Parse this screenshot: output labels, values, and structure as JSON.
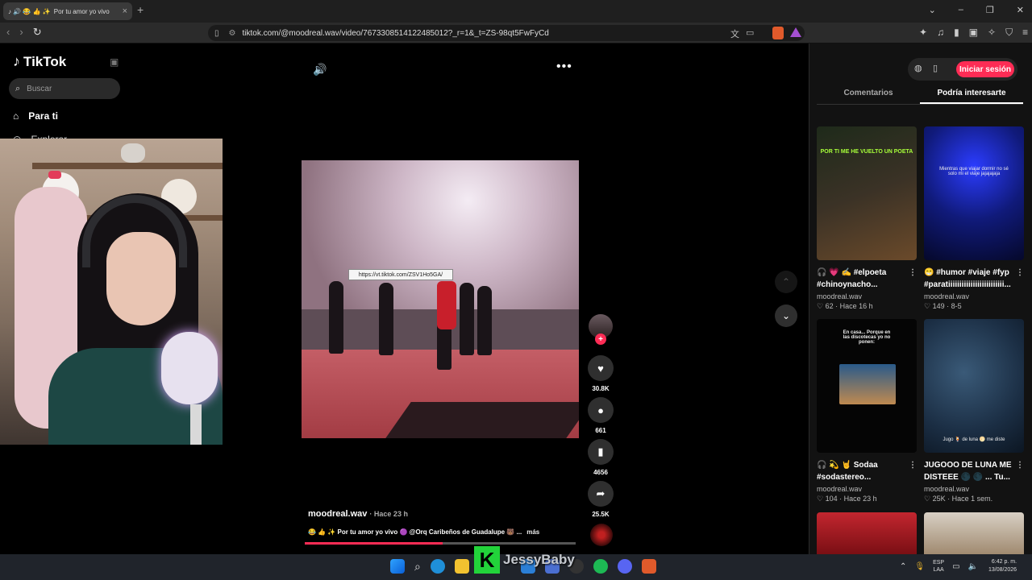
{
  "browser": {
    "tab_title": "Por tu amor yo vivo",
    "tab_icons": "♪ 🔊 😂 👍 ✨",
    "url": "tiktok.com/@moodreal.wav/video/7673308514122485012?_r=1&_t=ZS-98qt5FwFyCd"
  },
  "sidebar": {
    "logo": "TikTok",
    "search_placeholder": "Buscar",
    "foryou": "Para ti",
    "explore": "Explorar"
  },
  "video": {
    "link_tooltip": "https://vt.tiktok.com/ZSV1Ho5GA/",
    "author": "moodreal.wav",
    "time": "· Hace 23 h",
    "description": "😂 👍 ✨  Por tu amor yo vivo 🟣 @Orq Caribeños de Guadalupe 🐻 ...",
    "more_label": "más",
    "progress": 0.51
  },
  "actions": {
    "likes": "30.8K",
    "comments": "661",
    "saves": "4656",
    "shares": "25.5K"
  },
  "right_panel": {
    "login_label": "Iniciar sesión",
    "tab_comments": "Comentarios",
    "tab_suggested": "Podría interesarte",
    "cards": [
      {
        "title": "🎧 💗 ✍️ #elpoeta #chinoynacho...",
        "channel": "moodreal.wav",
        "stats": "♡ 62 · Hace 16 h",
        "thumb_text": "POR TI ME HE VUELTO UN POETA"
      },
      {
        "title": "😁 #humor #viaje #fyp #paratiiiiiiiiiiiiiiiiiiiiiiiii...",
        "channel": "moodreal.wav",
        "stats": "♡ 149 · 8-5",
        "thumb_text": "Mientras que viajar dormir no sé solo mi el viaje jajajajaja"
      },
      {
        "title": "🎧 💫 🤘 Sodaa #sodastereo...",
        "channel": "moodreal.wav",
        "stats": "♡ 104 · Hace 23 h",
        "thumb_text": "En casa... Porque en las discotecas yo no ponen:"
      },
      {
        "title": "JUGOOO DE LUNA ME DISTEEE 🌑 🌑 ... Tu...",
        "channel": "moodreal.wav",
        "stats": "♡ 25K · Hace 1 sem.",
        "thumb_text": "Jugo 🍹 de luna 🌕 me diste"
      }
    ]
  },
  "stream": {
    "k_letter": "K",
    "name": "JessyBaby"
  },
  "taskbar": {
    "lang1": "ESP",
    "lang2": "LAA",
    "time": "6:42 p. m.",
    "date": "13/08/2026"
  },
  "colors": {
    "accent": "#fe2c55",
    "brand_k": "#22d33a"
  }
}
